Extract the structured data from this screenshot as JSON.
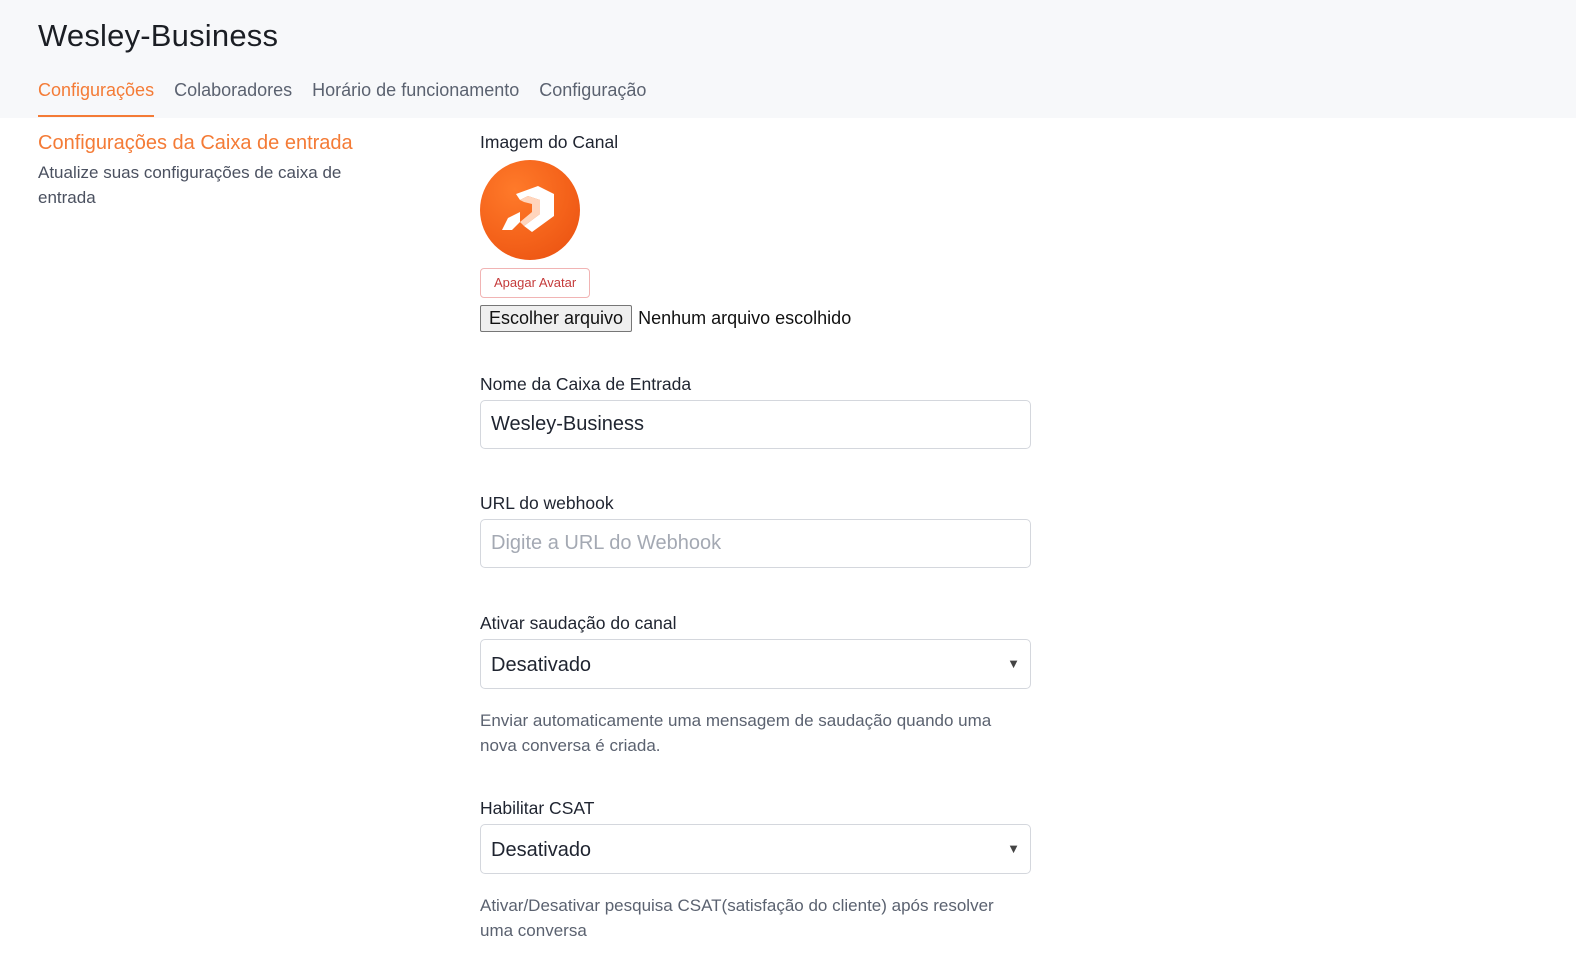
{
  "header": {
    "title": "Wesley-Business",
    "tabs": [
      {
        "label": "Configurações",
        "active": true
      },
      {
        "label": "Colaboradores",
        "active": false
      },
      {
        "label": "Horário de funcionamento",
        "active": false
      },
      {
        "label": "Configuração",
        "active": false
      }
    ]
  },
  "sidebar": {
    "title": "Configurações da Caixa de entrada",
    "description": "Atualize suas configurações de caixa de entrada"
  },
  "form": {
    "channel_image": {
      "label": "Imagem do Canal",
      "avatar_icon": "logo-icon",
      "remove_label": "Apagar Avatar",
      "file_button_label": "Escolher arquivo",
      "file_status": "Nenhum arquivo escolhido"
    },
    "inbox_name": {
      "label": "Nome da Caixa de Entrada",
      "value": "Wesley-Business"
    },
    "webhook_url": {
      "label": "URL do webhook",
      "value": "",
      "placeholder": "Digite a URL do Webhook"
    },
    "greeting": {
      "label": "Ativar saudação do canal",
      "selected": "Desativado",
      "help": "Enviar automaticamente uma mensagem de saudação quando uma nova conversa é criada."
    },
    "csat": {
      "label": "Habilitar CSAT",
      "selected": "Desativado",
      "help": "Ativar/Desativar pesquisa CSAT(satisfação do cliente) após resolver uma conversa"
    }
  },
  "colors": {
    "accent": "#f47b36",
    "danger": "#c53b3b",
    "header_bg": "#f7f8fa"
  }
}
